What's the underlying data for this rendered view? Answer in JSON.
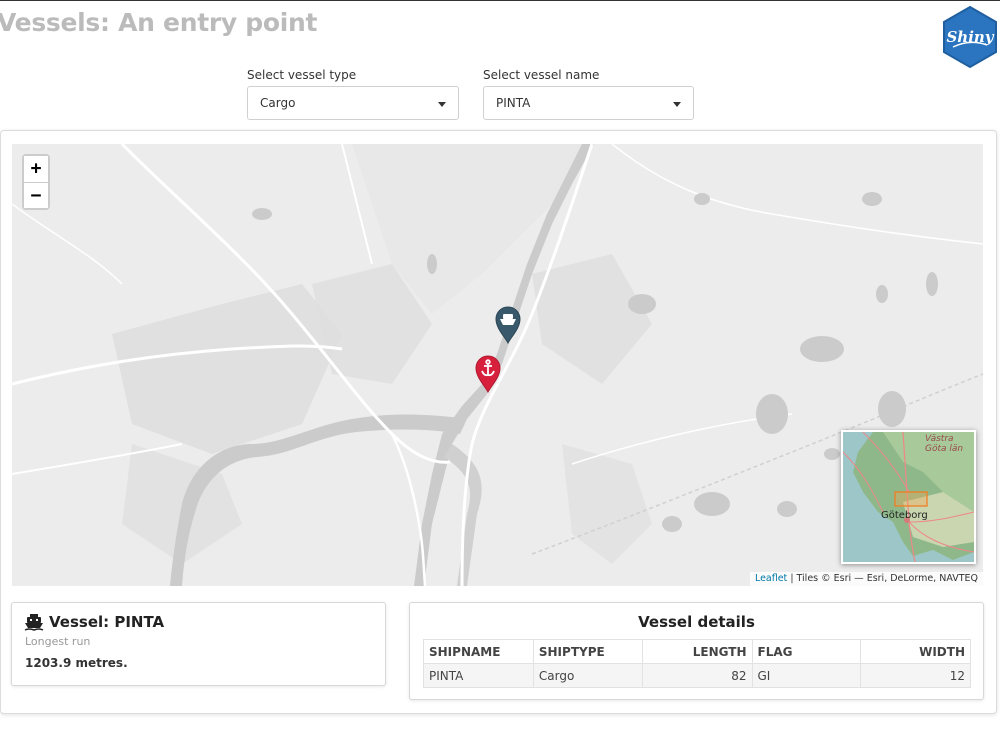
{
  "header": {
    "title": "Vessels: An entry point",
    "logo_text": "Shiny"
  },
  "filters": {
    "type_label": "Select vessel type",
    "type_value": "Cargo",
    "name_label": "Select vessel name",
    "name_value": "PINTA"
  },
  "map": {
    "zoom_in": "+",
    "zoom_out": "−",
    "markers": [
      {
        "name": "ship-marker",
        "icon": "ship-icon",
        "color": "#38596b"
      },
      {
        "name": "anchor-marker",
        "icon": "anchor-icon",
        "color": "#d6203c"
      }
    ],
    "minimap": {
      "city_label": "Göteborg",
      "region_label": "Västra Göta län"
    },
    "attribution": {
      "link": "Leaflet",
      "text": " | Tiles © Esri — Esri, DeLorme, NAVTEQ"
    }
  },
  "vessel_summary": {
    "title": "Vessel: PINTA",
    "subtitle": "Longest run",
    "distance": "1203.9 metres."
  },
  "details": {
    "title": "Vessel details",
    "columns": [
      "SHIPNAME",
      "SHIPTYPE",
      "LENGTH",
      "FLAG",
      "WIDTH"
    ],
    "row": [
      "PINTA",
      "Cargo",
      "82",
      "GI",
      "12"
    ]
  },
  "colors": {
    "accent": "#2a74c0",
    "ship_marker": "#38596b",
    "anchor_marker": "#d6203c"
  }
}
